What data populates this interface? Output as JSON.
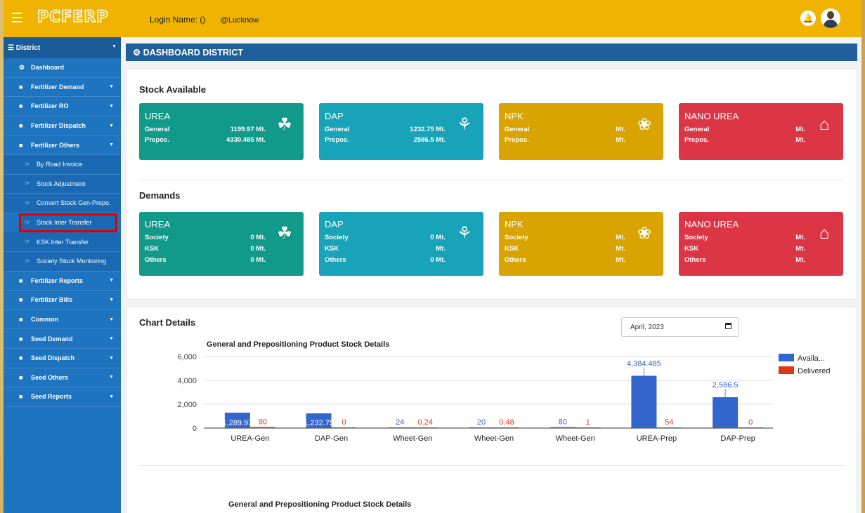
{
  "topbar": {
    "logo": "PCFERP",
    "login_label": "Login Name:  ()",
    "location": "@Lucknow",
    "bell_icon": "bell-icon",
    "avatar_icon": "user-avatar-icon"
  },
  "sidebar": {
    "header": "District",
    "items": [
      {
        "label": "Dashboard",
        "icon": "dashboard-icon",
        "caret": false,
        "sub": false
      },
      {
        "label": "Fertilizer Demand",
        "icon": "folder-icon",
        "caret": true,
        "sub": false
      },
      {
        "label": "Fertilizer RO",
        "icon": "folder-icon",
        "caret": true,
        "sub": false
      },
      {
        "label": "Fertilizer Dispatch",
        "icon": "folder-icon",
        "caret": true,
        "sub": false
      },
      {
        "label": "Fertilizer Others",
        "icon": "folder-icon",
        "caret": true,
        "sub": false
      },
      {
        "label": "By Road Invoice",
        "icon": "hand-point-icon",
        "caret": false,
        "sub": true
      },
      {
        "label": "Stock Adjustment",
        "icon": "hand-point-icon",
        "caret": false,
        "sub": true
      },
      {
        "label": "Convert Stock Gen-Prepo.",
        "icon": "hand-point-icon",
        "caret": false,
        "sub": true
      },
      {
        "label": "Stock Inter Transfer",
        "icon": "hand-point-icon",
        "caret": false,
        "sub": true,
        "highlight": true
      },
      {
        "label": "KSK Inter Transfer",
        "icon": "hand-point-icon",
        "caret": false,
        "sub": true
      },
      {
        "label": "Society Stock Monitoring",
        "icon": "hand-point-icon",
        "caret": false,
        "sub": true
      },
      {
        "label": "Fertilizer Reports",
        "icon": "folder-icon",
        "caret": true,
        "sub": false
      },
      {
        "label": "Fertilizer Bills",
        "icon": "folder-icon",
        "caret": true,
        "sub": false
      },
      {
        "label": "Common",
        "icon": "folder-icon",
        "caret": true,
        "sub": false
      },
      {
        "label": "Seed Demand",
        "icon": "folder-icon",
        "caret": true,
        "sub": false
      },
      {
        "label": "Seed Dispatch",
        "icon": "folder-icon",
        "caret": true,
        "sub": false
      },
      {
        "label": "Seed Others",
        "icon": "folder-icon",
        "caret": true,
        "sub": false
      },
      {
        "label": "Seed Reports",
        "icon": "folder-icon",
        "caret": true,
        "sub": false
      }
    ]
  },
  "main": {
    "header": "DASHBOARD DISTRICT",
    "stock_title": "Stock Available",
    "stock_cards": [
      {
        "name": "UREA",
        "rows": [
          {
            "k": "General",
            "v": "1199.97 Mt."
          },
          {
            "k": "Prepos.",
            "v": "4330.485 Mt."
          }
        ]
      },
      {
        "name": "DAP",
        "rows": [
          {
            "k": "General",
            "v": "1232.75 Mt."
          },
          {
            "k": "Prepos.",
            "v": "2586.5 Mt."
          }
        ]
      },
      {
        "name": "NPK",
        "rows": [
          {
            "k": "General",
            "v": "Mt."
          },
          {
            "k": "Prepos.",
            "v": "Mt."
          }
        ]
      },
      {
        "name": "NANO UREA",
        "rows": [
          {
            "k": "General",
            "v": "Mt."
          },
          {
            "k": "Prepos.",
            "v": "Mt."
          }
        ]
      }
    ],
    "demands_title": "Demands",
    "demand_cards": [
      {
        "name": "UREA",
        "rows": [
          {
            "k": "Society",
            "v": "0 Mt."
          },
          {
            "k": "KSK",
            "v": "0 Mt."
          },
          {
            "k": "Others",
            "v": "0 Mt."
          }
        ]
      },
      {
        "name": "DAP",
        "rows": [
          {
            "k": "Society",
            "v": "0 Mt."
          },
          {
            "k": "KSK",
            "v": "Mt."
          },
          {
            "k": "Others",
            "v": "0 Mt."
          }
        ]
      },
      {
        "name": "NPK",
        "rows": [
          {
            "k": "Society",
            "v": "Mt."
          },
          {
            "k": "KSK",
            "v": "Mt."
          },
          {
            "k": "Others",
            "v": "Mt."
          }
        ]
      },
      {
        "name": "NANO UREA",
        "rows": [
          {
            "k": "Society",
            "v": "Mt."
          },
          {
            "k": "KSK",
            "v": "Mt."
          },
          {
            "k": "Others",
            "v": "Mt."
          }
        ]
      }
    ],
    "chart_section_title": "Chart Details",
    "month_value": "April, 2023",
    "second_chart_title": "General and Prepositioning Product Stock Details"
  },
  "colors": {
    "topbar": "#f0b400",
    "sidebar": "#1f74bf",
    "header": "#1f5f9c",
    "teal": "#11998a",
    "cyan": "#18a3b8",
    "gold": "#d9a400",
    "red": "#dc3545",
    "series_available": "#3366cc",
    "series_delivered": "#dc3912"
  },
  "chart_data": {
    "type": "bar",
    "title": "General and Prepositioning Product Stock Details",
    "categories": [
      "UREA-Gen",
      "DAP-Gen",
      "Wheet-Gen",
      "Wheet-Gen",
      "Wheet-Gen",
      "UREA-Prep",
      "DAP-Prep"
    ],
    "series": [
      {
        "name": "Availa...",
        "values": [
          1289.97,
          1232.75,
          24,
          20,
          80,
          4384.485,
          2586.5
        ],
        "labels": [
          "1,289.97",
          "1,232.75",
          "24",
          "20",
          "80",
          "4,384.485",
          "2,586.5"
        ]
      },
      {
        "name": "Delivered",
        "values": [
          90,
          0,
          0.24,
          0.48,
          1,
          54,
          0
        ],
        "labels": [
          "90",
          "0",
          "0.24",
          "0.48",
          "1",
          "54",
          "0"
        ]
      }
    ],
    "yticks": [
      "6,000",
      "4,000",
      "2,000",
      "0"
    ],
    "ylim": [
      0,
      6000
    ],
    "legend": "right"
  }
}
